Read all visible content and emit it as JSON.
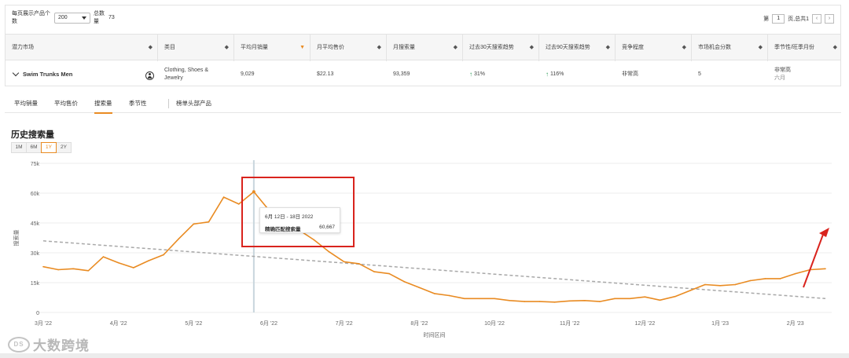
{
  "toolbar": {
    "per_page_label": "每页展示产品个数",
    "per_page_value": "200",
    "total_label": "总数量",
    "total_value": "73",
    "pager_prefix": "第",
    "pager_page": "1",
    "pager_suffix": "页,总共1",
    "prev_icon": "chevron-left-icon",
    "next_icon": "chevron-right-icon"
  },
  "table": {
    "headers": [
      "潜力市场",
      "类目",
      "平均月销量",
      "月平均售价",
      "月搜索量",
      "过去30天搜索趋势",
      "过去90天搜索趋势",
      "竞争程度",
      "市场机会分数",
      "季节性/旺季月份"
    ],
    "active_sort_color": "#e98b22",
    "row": {
      "market": "Swim Trunks Men",
      "category": "Clothing, Shoes & Jewelry",
      "avg_monthly_sales": "9,029",
      "avg_price": "$22.13",
      "monthly_search": "93,359",
      "trend_30": "31%",
      "trend_90": "116%",
      "competition": "非常高",
      "opportunity_score": "5",
      "seasonality": "非常高",
      "peak_month": "六月"
    }
  },
  "tabs": [
    {
      "label": "平均销量",
      "active": false
    },
    {
      "label": "平均售价",
      "active": false
    },
    {
      "label": "搜索量",
      "active": true
    },
    {
      "label": "季节性",
      "active": false
    },
    {
      "label": "榜单头部产品",
      "active": false
    }
  ],
  "chart_section": {
    "title": "历史搜索量",
    "ranges": [
      {
        "label": "1M",
        "active": false
      },
      {
        "label": "6M",
        "active": false
      },
      {
        "label": "1Y",
        "active": true
      },
      {
        "label": "2Y",
        "active": false
      }
    ]
  },
  "tooltip": {
    "date_range": "6月 12日 - 18日 2022",
    "label": "精确匹配搜索量",
    "value": "60,667"
  },
  "watermark": {
    "logo_text": "DS",
    "text": "大数跨境"
  },
  "chart_data": {
    "type": "line",
    "xlabel": "时间区间",
    "ylabel": "搜索量",
    "ylim": [
      0,
      75000
    ],
    "yticks": [
      0,
      15000,
      30000,
      45000,
      60000,
      75000
    ],
    "ytick_labels": [
      "0",
      "15k",
      "30k",
      "45k",
      "60k",
      "75k"
    ],
    "xtick_labels": [
      "3月 '22",
      "4月 '22",
      "5月 '22",
      "6月 '22",
      "7月 '22",
      "8月 '22",
      "10月 '22",
      "11月 '22",
      "12月 '22",
      "1月 '23",
      "2月 '23"
    ],
    "xtick_positions": [
      0,
      5,
      10,
      15,
      20,
      25,
      30,
      35,
      40,
      45,
      50
    ],
    "grid": true,
    "line_color": "#e98b22",
    "trend_color": "#a8a8a8",
    "hover_index": 14,
    "series": [
      {
        "values": [
          23000,
          21500,
          22000,
          21000,
          28000,
          25000,
          22500,
          26000,
          29000,
          37000,
          44500,
          45500,
          58000,
          54500,
          60667,
          51500,
          50500,
          41500,
          36500,
          30500,
          25500,
          24500,
          20500,
          19500,
          15500,
          12500,
          9500,
          8500,
          7000,
          7000,
          7000,
          6000,
          5500,
          5500,
          5200,
          5800,
          6000,
          5500,
          7000,
          7000,
          7800,
          6200,
          8000,
          11000,
          14000,
          13500,
          14000,
          16000,
          17000,
          17000,
          19500,
          21500,
          22000
        ]
      }
    ],
    "trend": {
      "start_value": 36000,
      "end_value": 7000
    }
  }
}
